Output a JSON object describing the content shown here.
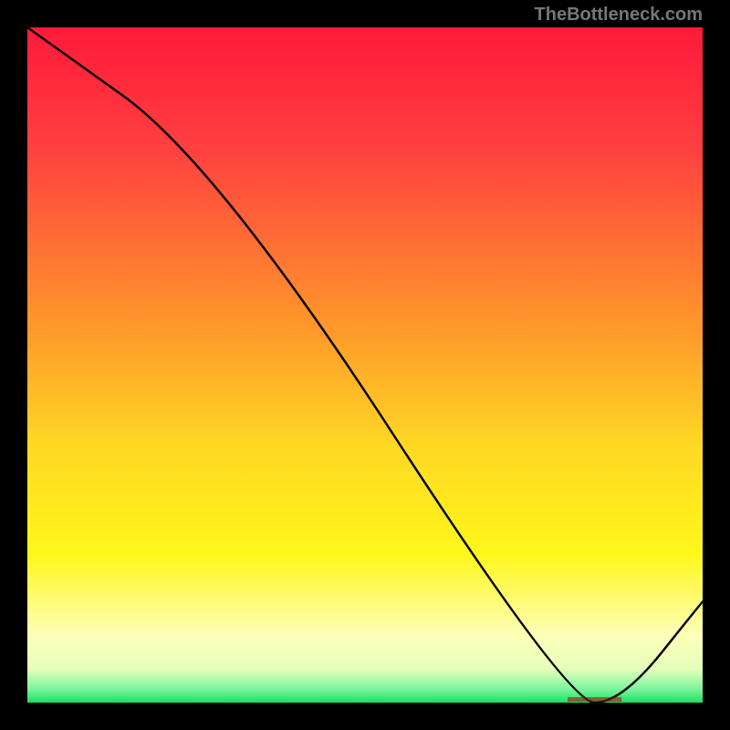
{
  "watermark": "TheBottleneck.com",
  "chart_data": {
    "type": "line",
    "title": "",
    "xlabel": "",
    "ylabel": "",
    "xlim": [
      0,
      100
    ],
    "ylim": [
      0,
      100
    ],
    "x": [
      0,
      28,
      80,
      88,
      100
    ],
    "values": [
      100,
      80,
      0,
      0,
      15
    ],
    "notes": "Vertical gradient background red→orange→yellow→pale-yellow→green; a black line descending from top-left, kinking gently around x≈28 then steeper to the bottom around x≈80, flat along bottom to x≈88, rising to y≈15 at right edge. Axes unlabeled; rendered inside a 740×740 plot on an 800×800 black canvas."
  },
  "colors": {
    "bg": "#000000",
    "line": "#000000",
    "watermark": "#777777",
    "gradient_stops": [
      {
        "pct": 0,
        "color": "#ff1a3a"
      },
      {
        "pct": 18,
        "color": "#ff4040"
      },
      {
        "pct": 45,
        "color": "#ff9a2a"
      },
      {
        "pct": 62,
        "color": "#ffd824"
      },
      {
        "pct": 78,
        "color": "#fff71a"
      },
      {
        "pct": 90,
        "color": "#fdffb8"
      },
      {
        "pct": 95,
        "color": "#e6ffba"
      },
      {
        "pct": 98,
        "color": "#7cf49e"
      },
      {
        "pct": 100,
        "color": "#18e060"
      }
    ]
  }
}
